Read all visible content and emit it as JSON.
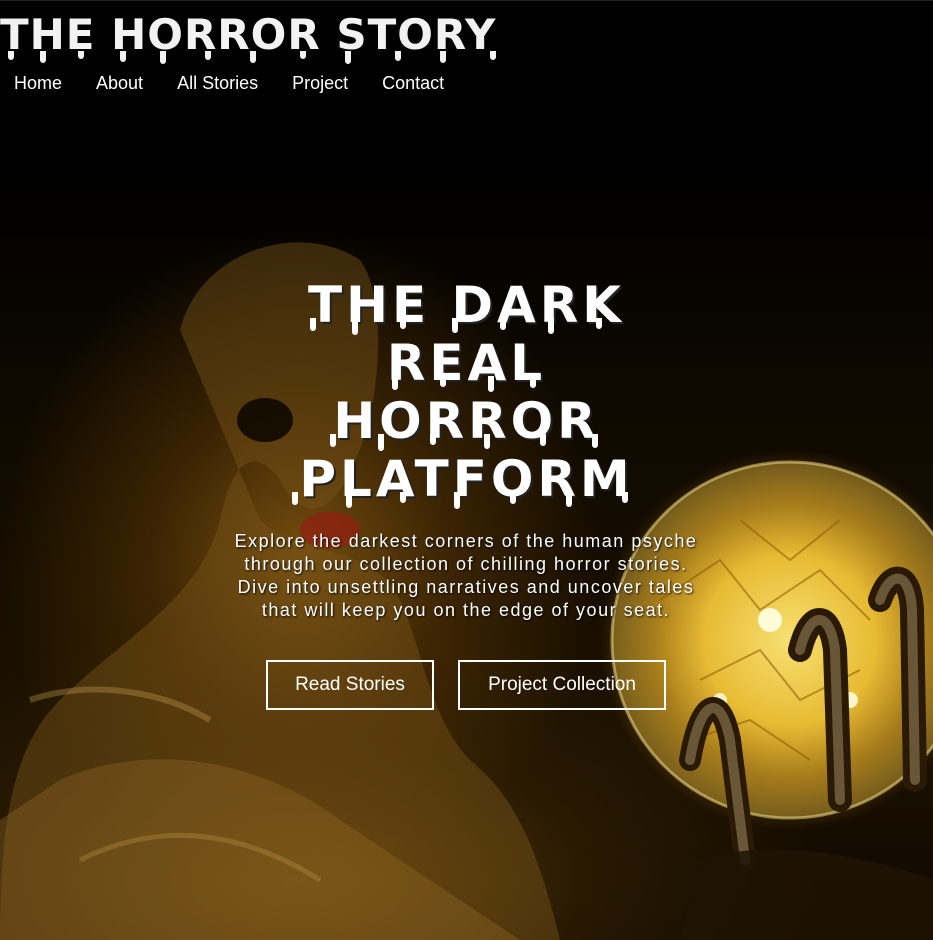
{
  "header": {
    "logo_text": "THE HORROR STORY",
    "nav": [
      {
        "label": "Home"
      },
      {
        "label": "About"
      },
      {
        "label": "All Stories"
      },
      {
        "label": "Project"
      },
      {
        "label": "Contact"
      }
    ]
  },
  "hero": {
    "title_lines": [
      "THE DARK",
      "REAL",
      "HORROR",
      "PLATFORM"
    ],
    "description": "Explore the darkest corners of the human psyche through our collection of chilling horror stories. Dive into unsettling narratives and uncover tales that will keep you on the edge of your seat.",
    "buttons": {
      "read_label": "Read Stories",
      "project_label": "Project Collection"
    },
    "background_image": "skull-and-crystal-ball-scene"
  },
  "colors": {
    "background": "#000000",
    "text": "#ffffff",
    "glow": "#f0be28"
  }
}
